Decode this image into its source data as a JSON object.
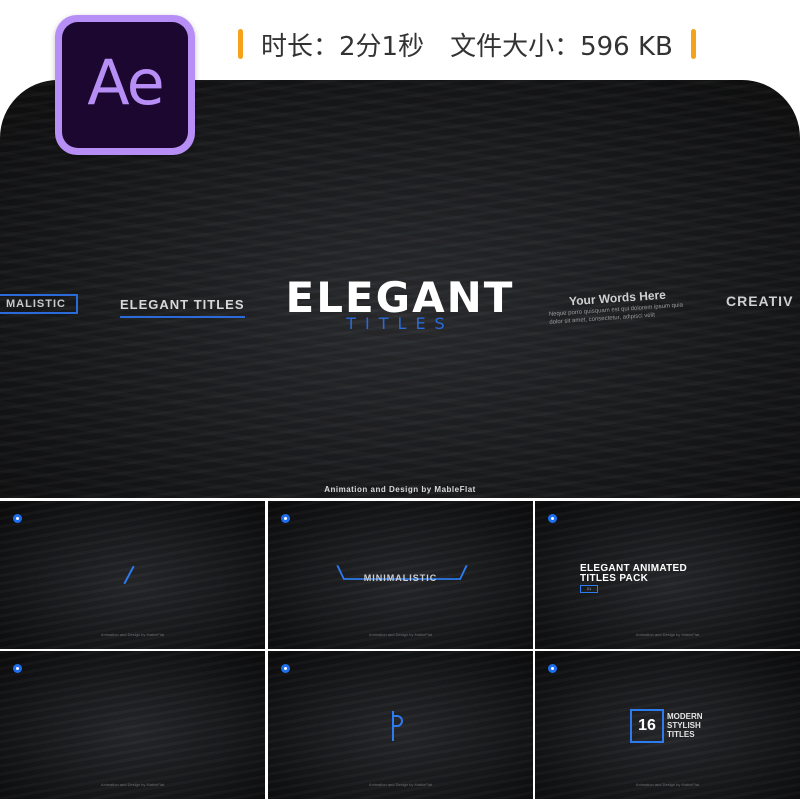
{
  "app_logo": {
    "text": "Ae",
    "bg": "#1b0730",
    "accent": "#b78ef5"
  },
  "info_bar": {
    "duration": "时长：2分1秒",
    "filesize": "文件大小：596 KB",
    "marker_color": "#f6a21a"
  },
  "hero": {
    "main_title": "ELEGANT",
    "main_subtitle": "TITLES",
    "left_tag": "MALISTIC",
    "left_title": "ELEGANT TITLES",
    "right_title": "Your Words Here",
    "right_sub": "Neque porro quisquam est qui dolorem ipsum quia dolor sit amet, consectetur, adipisci velit",
    "far_right": "CREATIV",
    "credit": "Animation and Design by MableFlat",
    "accent": "#2a6ad9"
  },
  "thumbnails": [
    {
      "credit": "Animation and Design by MableFlat"
    },
    {
      "label": "MINIMALISTIC",
      "credit": "Animation and Design by MableFlat"
    },
    {
      "title_line1": "ELEGANT ANIMATED",
      "title_line2": "TITLES PACK",
      "badge": "01",
      "credit": "Animation and Design by MableFlat"
    },
    {
      "credit": "Animation and Design by MableFlat"
    },
    {
      "credit": "Animation and Design by MableFlat"
    },
    {
      "number": "16",
      "line1": "MODERN",
      "line2": "STYLISH",
      "line3": "TITLES",
      "credit": "Animation and Design by MableFlat"
    }
  ]
}
